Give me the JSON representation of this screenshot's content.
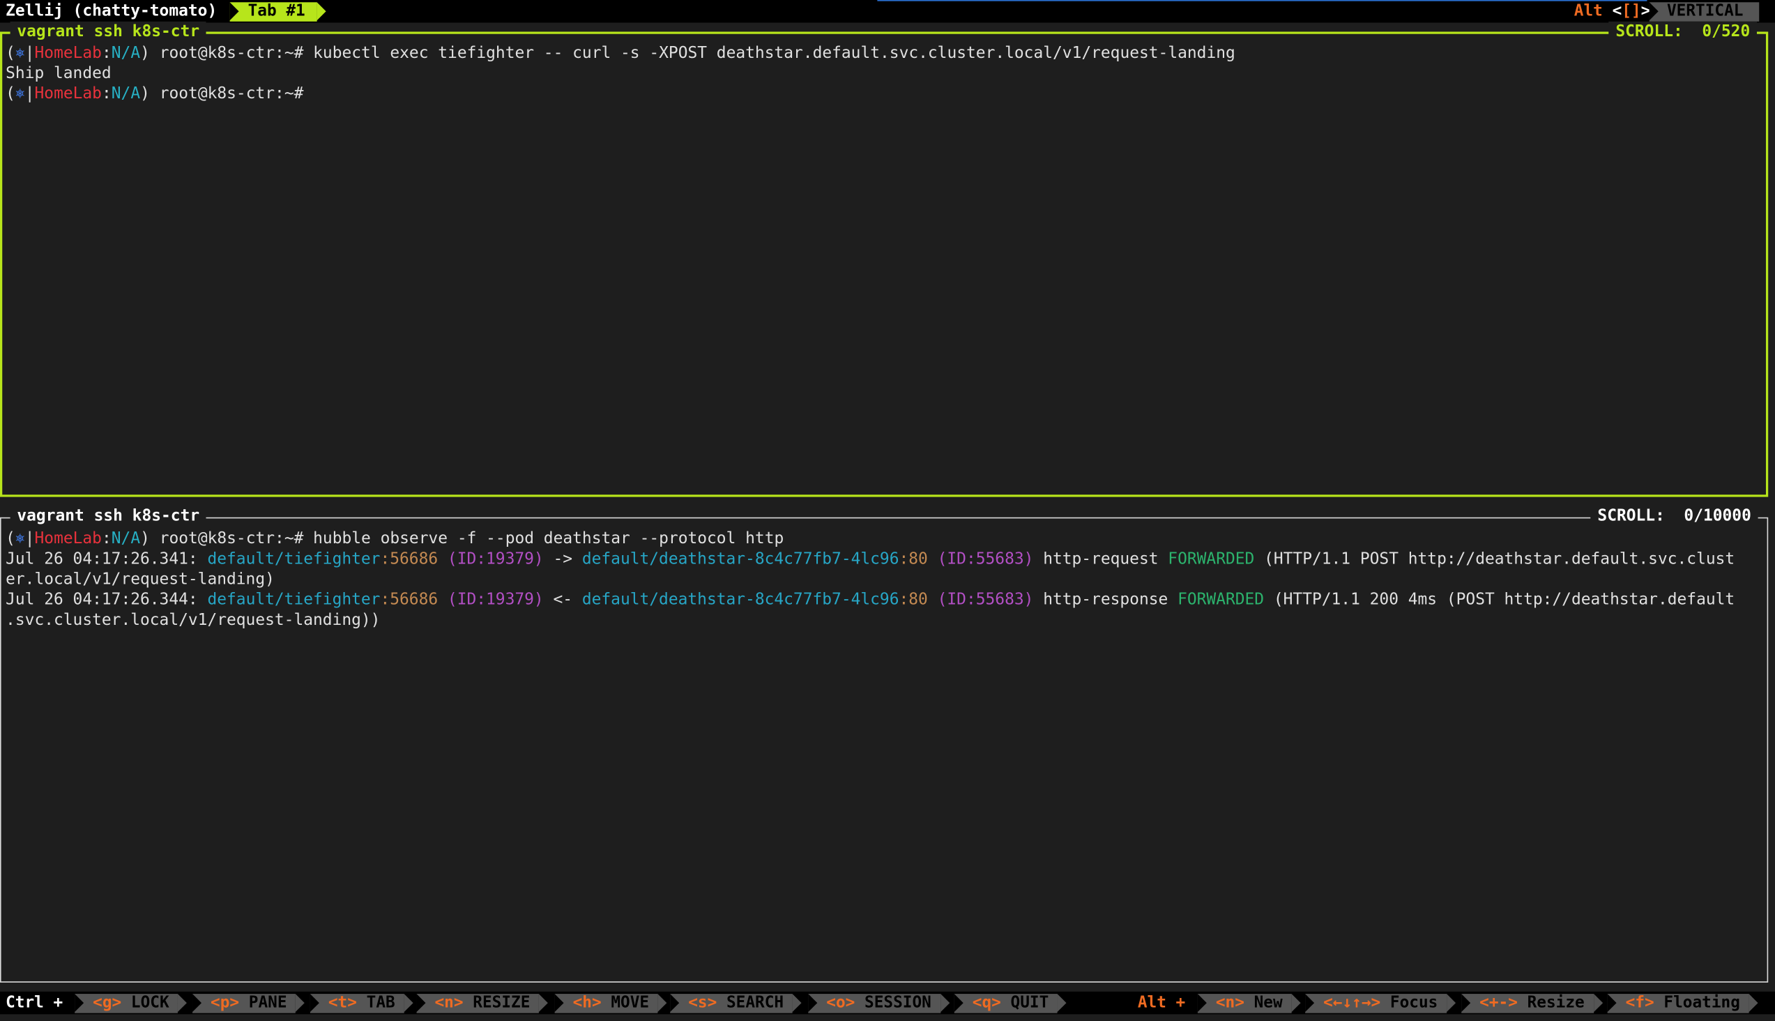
{
  "topbar": {
    "session": "Zellij (chatty-tomato)",
    "tab_label": "Tab #1",
    "alt_prefix": "Alt",
    "alt_bracket_open": "<",
    "alt_bracket_keys": "[]",
    "alt_bracket_close": ">",
    "mode_label": "VERTICAL"
  },
  "pane_top": {
    "title": "vagrant ssh k8s-ctr",
    "scroll": "SCROLL:  0/520",
    "prompt": {
      "open": "(",
      "icon": "⎈",
      "sep": "|",
      "context": "HomeLab",
      "colon": ":",
      "namespace": "N/A",
      "close": ")",
      "user": " root@k8s-ctr:~# "
    },
    "command": "kubectl exec tiefighter -- curl -s -XPOST deathstar.default.svc.cluster.local/v1/request-landing",
    "output": "Ship landed",
    "command2": ""
  },
  "pane_bottom": {
    "title": "vagrant ssh k8s-ctr",
    "scroll": "SCROLL:  0/10000",
    "command": "hubble observe -f --pod deathstar --protocol http",
    "flows": [
      {
        "time": "Jul 26 04:17:26.341: ",
        "src": "default/tiefighter",
        "src_port": ":56686",
        "src_id": " (ID:19379) ",
        "arrow": "-> ",
        "dst": "default/deathstar-8c4c77fb7-4lc96",
        "dst_port": ":80",
        "dst_id": " (ID:55683) ",
        "kind": "http-request ",
        "verdict": "FORWARDED",
        "detail": " (HTTP/1.1 POST http://deathstar.default.svc.clust",
        "wrap": "er.local/v1/request-landing)"
      },
      {
        "time": "Jul 26 04:17:26.344: ",
        "src": "default/tiefighter",
        "src_port": ":56686",
        "src_id": " (ID:19379) ",
        "arrow": "<- ",
        "dst": "default/deathstar-8c4c77fb7-4lc96",
        "dst_port": ":80",
        "dst_id": " (ID:55683) ",
        "kind": "http-response ",
        "verdict": "FORWARDED",
        "detail": " (HTTP/1.1 200 4ms (POST http://deathstar.default",
        "wrap": ".svc.cluster.local/v1/request-landing))"
      }
    ]
  },
  "bottombar": {
    "ctrl": "Ctrl +",
    "keys": [
      {
        "key": "<g>",
        "label": " LOCK"
      },
      {
        "key": "<p>",
        "label": " PANE"
      },
      {
        "key": "<t>",
        "label": " TAB"
      },
      {
        "key": "<n>",
        "label": " RESIZE"
      },
      {
        "key": "<h>",
        "label": " MOVE"
      },
      {
        "key": "<s>",
        "label": " SEARCH"
      },
      {
        "key": "<o>",
        "label": " SESSION"
      },
      {
        "key": "<q>",
        "label": " QUIT"
      }
    ],
    "alt": "Alt +",
    "alt_keys": [
      {
        "key": "<n>",
        "label": " New"
      },
      {
        "key": "<←↓↑→>",
        "label": " Focus"
      },
      {
        "key": "<+->",
        "label": " Resize"
      },
      {
        "key": "<f>",
        "label": " Floating"
      }
    ]
  },
  "colors": {
    "accent": "#b7e51b",
    "alt": "#ef6b22",
    "context": "#e8323c",
    "namespace": "#27b0c4",
    "identity": "#b24fc4",
    "verdict": "#2cb36d"
  }
}
